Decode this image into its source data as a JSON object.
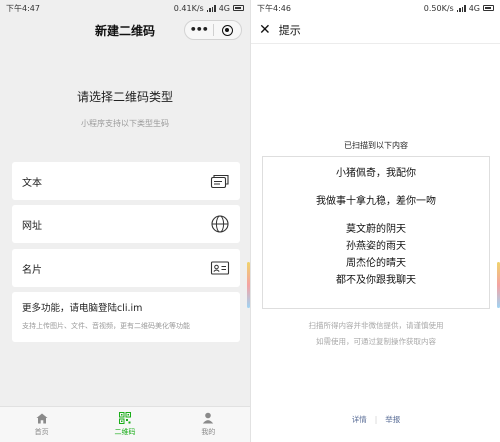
{
  "left": {
    "status": {
      "time": "下午4:47",
      "speed": "0.41K/s",
      "network": "4G"
    },
    "nav": {
      "title": "新建二维码",
      "more_glyph": "•••"
    },
    "headline": "请选择二维码类型",
    "subline": "小程序支持以下类型生码",
    "options": [
      {
        "label": "文本",
        "icon": "message-icon"
      },
      {
        "label": "网址",
        "icon": "globe-icon"
      },
      {
        "label": "名片",
        "icon": "id-card-icon"
      }
    ],
    "more": {
      "title": "更多功能，请电脑登陆cli.im",
      "subtitle": "支持上传图片、文件、音视频，更有二维码美化等功能"
    },
    "tabs": [
      {
        "label": "首页",
        "icon": "home-icon",
        "active": false
      },
      {
        "label": "二维码",
        "icon": "qr-code-icon",
        "active": true
      },
      {
        "label": "我的",
        "icon": "person-icon",
        "active": false
      }
    ]
  },
  "right": {
    "status": {
      "time": "下午4:46",
      "speed": "0.50K/s",
      "network": "4G"
    },
    "nav": {
      "close_glyph": "✕",
      "title": "提示"
    },
    "scanned_label": "已扫描到以下内容",
    "content_lines": [
      "小猪佩奇，我配你",
      "",
      "我做事十拿九稳，差你一吻",
      "",
      "莫文蔚的阴天",
      "孙燕姿的雨天",
      "周杰伦的晴天",
      "都不及你跟我聊天"
    ],
    "disclaimer": [
      "扫描所得内容并非微信提供，请谨慎使用",
      "如需使用，可通过复制操作获取内容"
    ],
    "footer": {
      "details": "详情",
      "divider": "|",
      "report": "举报"
    }
  },
  "colors": {
    "accent_green": "#1aad19",
    "link_blue": "#576b95",
    "muted": "#9a9a9a"
  }
}
